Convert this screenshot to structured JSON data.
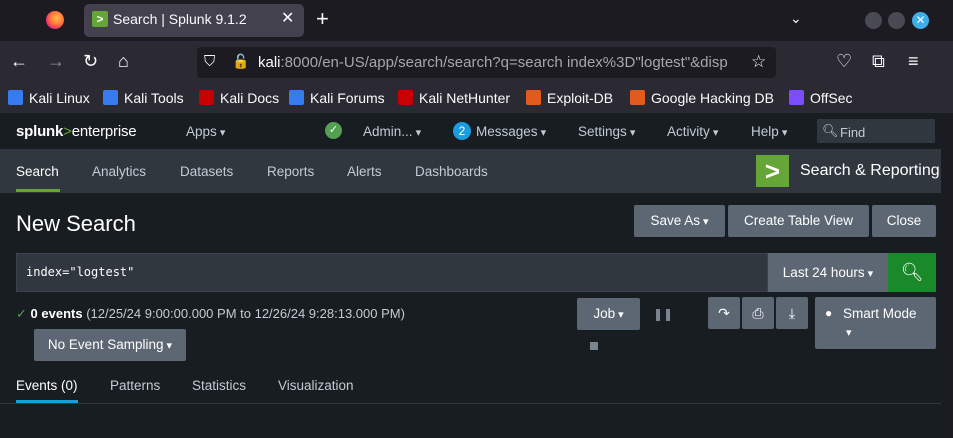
{
  "browser": {
    "tab_title": "Search | Splunk 9.1.2",
    "tab_close": "✕",
    "new_tab": "+",
    "tab_list": "⌄",
    "url_host": "kali",
    "url_rest": ":8000/en-US/app/search/search?q=search index%3D\"logtest\"&disp",
    "bookmarks": [
      {
        "label": "Kali Linux",
        "icon": "kali-dragon-icon",
        "color": "#367bf0"
      },
      {
        "label": "Kali Tools",
        "icon": "kali-tools-icon",
        "color": "#367bf0"
      },
      {
        "label": "Kali Docs",
        "icon": "kali-docs-icon",
        "color": "#c80000"
      },
      {
        "label": "Kali Forums",
        "icon": "kali-forums-icon",
        "color": "#367bf0"
      },
      {
        "label": "Kali NetHunter",
        "icon": "nethunter-icon",
        "color": "#c80000"
      },
      {
        "label": "Exploit-DB",
        "icon": "exploit-db-icon",
        "color": "#e25a1c"
      },
      {
        "label": "Google Hacking DB",
        "icon": "ghdb-icon",
        "color": "#e25a1c"
      },
      {
        "label": "OffSec",
        "icon": "offsec-icon",
        "color": "#7b4dff"
      }
    ]
  },
  "splunk": {
    "logo_prefix": "splunk",
    "logo_gt": ">",
    "logo_suffix": "enterprise",
    "apps": "Apps",
    "admin": "Admin...",
    "messages_count": "2",
    "messages": "Messages",
    "settings": "Settings",
    "activity": "Activity",
    "help": "Help",
    "find_placeholder": "Find",
    "app_tabs": [
      "Search",
      "Analytics",
      "Datasets",
      "Reports",
      "Alerts",
      "Dashboards"
    ],
    "app_name": "Search & Reporting",
    "page_title": "New Search",
    "save_as": "Save As",
    "create_table_view": "Create Table View",
    "close": "Close",
    "query": "index=\"logtest\"",
    "time_range": "Last 24 hours",
    "status_count": "0 events",
    "status_range": " (12/25/24 9:00:00.000 PM to 12/26/24 9:28:13.000 PM)",
    "job": "Job",
    "sampling": "No Event Sampling",
    "smart_mode": "Smart Mode",
    "result_tabs": [
      "Events (0)",
      "Patterns",
      "Statistics",
      "Visualization"
    ]
  },
  "colors": {
    "splunk_green": "#65a637",
    "search_button": "#1a8929",
    "active_underline": "#1a9ce0"
  }
}
